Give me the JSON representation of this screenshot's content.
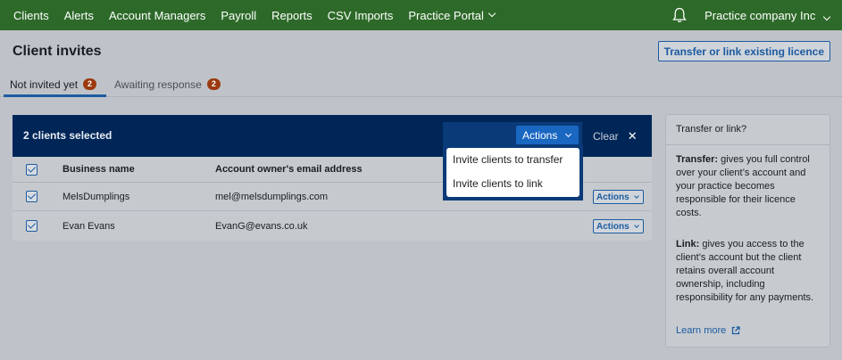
{
  "nav": {
    "items": [
      "Clients",
      "Alerts",
      "Account Managers",
      "Payroll",
      "Reports",
      "CSV Imports",
      "Practice Portal"
    ],
    "company": "Practice company Inc",
    "bell_icon": "bell-icon"
  },
  "page": {
    "title": "Client invites",
    "transfer_button": "Transfer or link existing licence"
  },
  "tabs": [
    {
      "label": "Not invited yet",
      "count": "2"
    },
    {
      "label": "Awaiting response",
      "count": "2"
    }
  ],
  "selection": {
    "text": "2 clients selected",
    "actions_label": "Actions",
    "clear_label": "Clear",
    "close_glyph": "✕"
  },
  "dropdown": {
    "items": [
      "Invite clients to transfer",
      "Invite clients to link"
    ]
  },
  "table": {
    "headers": [
      "Business name",
      "Account owner's email address"
    ],
    "rows": [
      {
        "name": "MelsDumplings",
        "email": "mel@melsdumplings.com",
        "action": "Actions"
      },
      {
        "name": "Evan Evans",
        "email": "EvanG@evans.co.uk",
        "action": "Actions"
      }
    ]
  },
  "side_panel": {
    "title": "Transfer or link?",
    "transfer_label": "Transfer:",
    "transfer_text": "gives you full control over your client’s account and your practice becomes responsible for their licence costs.",
    "link_label": "Link:",
    "link_text": "gives you access to the client’s account but the client retains overall account ownership, including responsibility for any payments.",
    "learn_more": "Learn more"
  },
  "colors": {
    "nav_green": "#2d6a29",
    "selection_bar": "#002658",
    "accent_blue": "#1d5ba0",
    "badge_orange": "#9c3a10"
  }
}
